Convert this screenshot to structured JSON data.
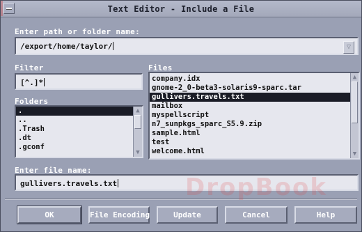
{
  "window": {
    "title": "Text Editor - Include a File"
  },
  "path": {
    "label": "Enter path or folder name:",
    "value": "/export/home/taylor/"
  },
  "filter": {
    "label": "Filter",
    "value": "[^.]*"
  },
  "folders": {
    "label": "Folders",
    "items": [
      ".",
      "..",
      ".Trash",
      ".dt",
      ".gconf"
    ],
    "selected_index": 0
  },
  "files": {
    "label": "Files",
    "items": [
      "company.idx",
      "gnome-2_0-beta3-solaris9-sparc.tar",
      "gullivers.travels.txt",
      "mailbox",
      "myspellscript",
      "n7_sunpkgs_sparc_S5.9.zip",
      "sample.html",
      "test",
      "welcome.html"
    ],
    "selected_index": 2
  },
  "filename": {
    "label": "Enter file name:",
    "value": "gullivers.travels.txt"
  },
  "buttons": {
    "ok": "OK",
    "file_encoding": "File Encoding",
    "update": "Update",
    "cancel": "Cancel",
    "help": "Help"
  },
  "watermark": "DropBook",
  "colors": {
    "window_bg": "#9aa0b4",
    "selection_bg": "#1a1c26",
    "field_bg": "#e6e7ee"
  }
}
